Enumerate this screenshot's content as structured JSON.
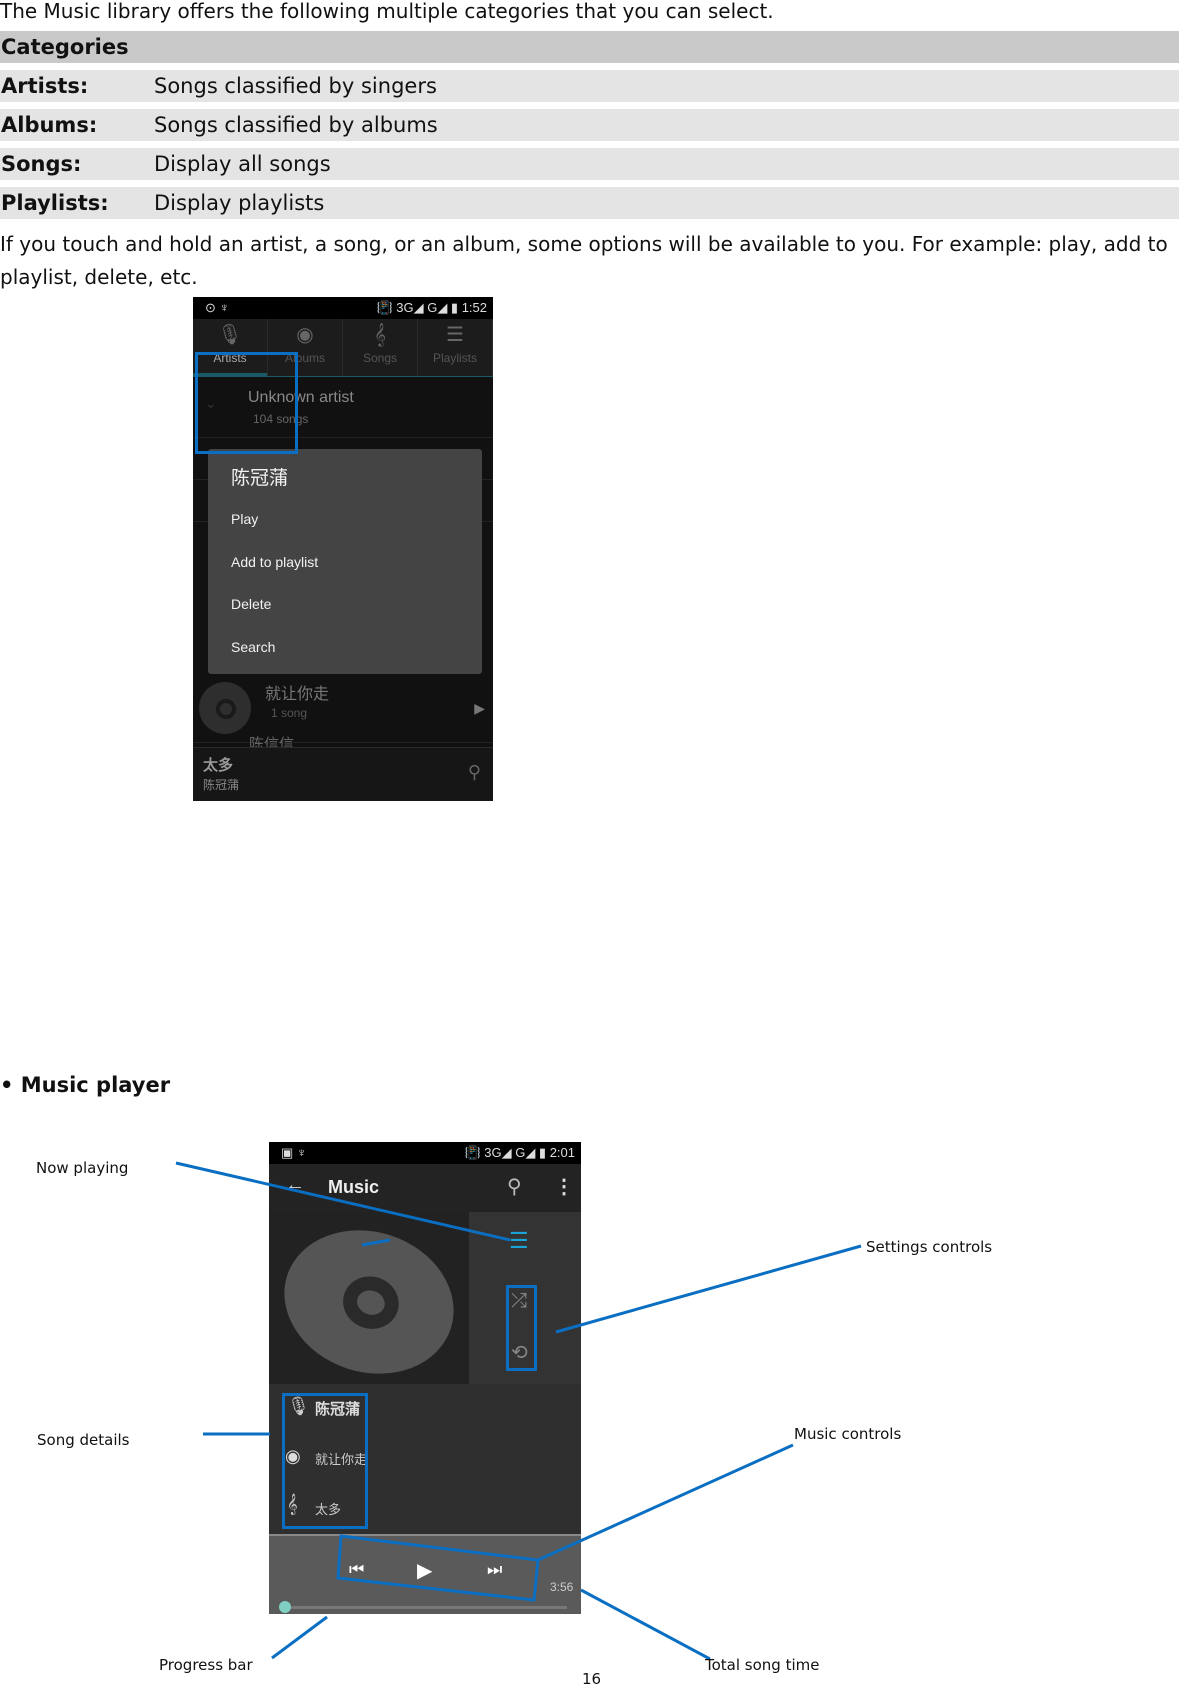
{
  "intro": "The Music library offers the following multiple categories that you can select.",
  "table": {
    "header": "Categories",
    "rows": [
      {
        "key": "Artists:",
        "value": "Songs classified by singers"
      },
      {
        "key": "Albums:",
        "value": "Songs classified by albums"
      },
      {
        "key": "Songs:",
        "value": "Display all songs"
      },
      {
        "key": "Playlists:",
        "value": "Display playlists"
      }
    ]
  },
  "paragraph": "If you touch and hold an artist, a song, or an album, some options will be available to you. For example: play, add to playlist, delete, etc.",
  "library_screen": {
    "status": {
      "left": "⊙  ♆",
      "right": "📳 3G◢ G◢ ▮ 1:52",
      "time": "1:52"
    },
    "tabs": [
      {
        "label": "Artists",
        "icon": "microphone-icon",
        "glyph": "🎙"
      },
      {
        "label": "Albums",
        "icon": "disc-icon",
        "glyph": "◉"
      },
      {
        "label": "Songs",
        "icon": "treble-clef-icon",
        "glyph": "𝄞"
      },
      {
        "label": "Playlists",
        "icon": "playlist-icon",
        "glyph": "☰"
      }
    ],
    "artist_row": {
      "name": "Unknown artist",
      "count": "104 songs"
    },
    "context_menu": {
      "title": "陈冠蒲",
      "items": [
        "Play",
        "Add to playlist",
        "Delete",
        "Search"
      ]
    },
    "album_row": {
      "name": "就让你走",
      "count": "1 song"
    },
    "next_artist": "陈信信",
    "now_playing": {
      "title": "太多",
      "artist": "陈冠蒲"
    }
  },
  "section_heading": "• Music player",
  "player_screen": {
    "status": {
      "left": "▣  ♆",
      "right": "📳 3G◢ G◢ ▮ 2:01"
    },
    "title": "Music",
    "artist": "陈冠蒲",
    "album": "就让你走",
    "song": "太多",
    "total_time": "3:56",
    "progress": 0.0
  },
  "callouts": {
    "now_playing": "Now playing",
    "settings_controls": "Settings controls",
    "song_details": "Song details",
    "music_controls": "Music controls",
    "progress_bar": "Progress bar",
    "total_song_time": "Total song time"
  },
  "page_number": "16",
  "colors": {
    "annotation_blue": "#0a6fc2",
    "accent_teal": "#7fcfc3"
  }
}
